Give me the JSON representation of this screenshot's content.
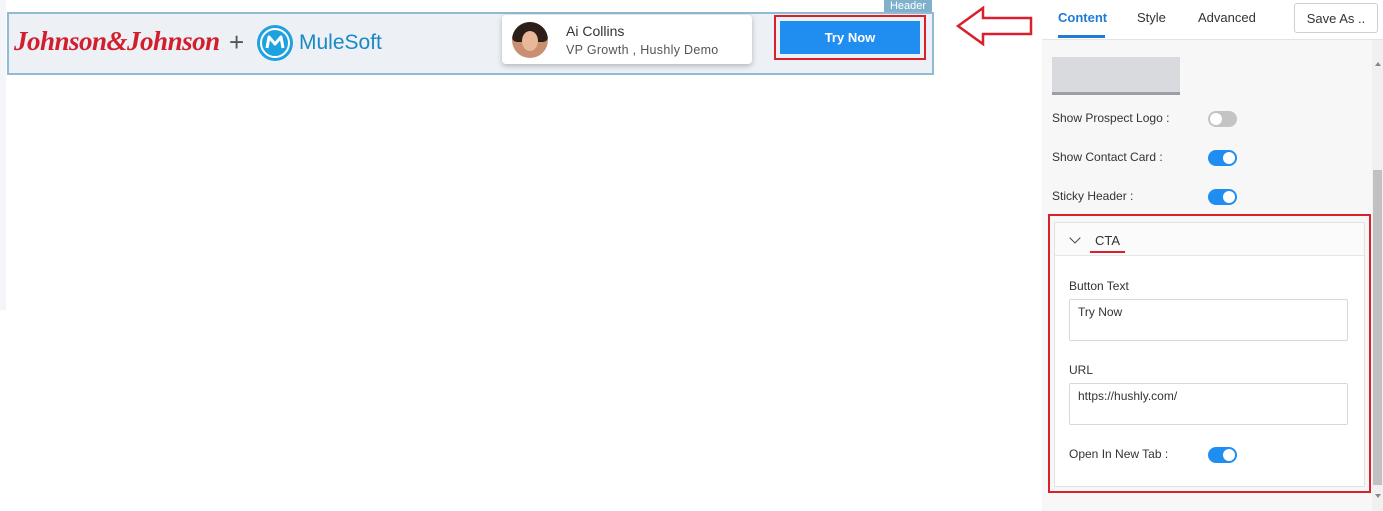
{
  "preview": {
    "header_tag": "Header",
    "logo_text": "Johnson&Johnson",
    "plus": "+",
    "partner_name": "MuleSoft",
    "contact": {
      "name": "Ai Collins",
      "title": "VP Growth , Hushly Demo"
    },
    "cta_label": "Try Now"
  },
  "panel": {
    "tabs": [
      {
        "label": "Content",
        "active": true
      },
      {
        "label": "Style",
        "active": false
      },
      {
        "label": "Advanced",
        "active": false
      }
    ],
    "save_label": "Save As ..",
    "toggles": [
      {
        "label": "Show Prospect Logo :",
        "on": false
      },
      {
        "label": "Show Contact Card :",
        "on": true
      },
      {
        "label": "Sticky Header :",
        "on": true
      }
    ],
    "cta": {
      "section_title": "CTA",
      "button_text_label": "Button Text",
      "button_text_value": "Try Now",
      "url_label": "URL",
      "url_value": "https://hushly.com/",
      "new_tab_label": "Open In New Tab :",
      "new_tab_on": true
    }
  },
  "colors": {
    "accent": "#1f8ef0",
    "highlight": "#d9202c",
    "brand_red": "#d11f2d",
    "mule_blue": "#1da1e0"
  }
}
